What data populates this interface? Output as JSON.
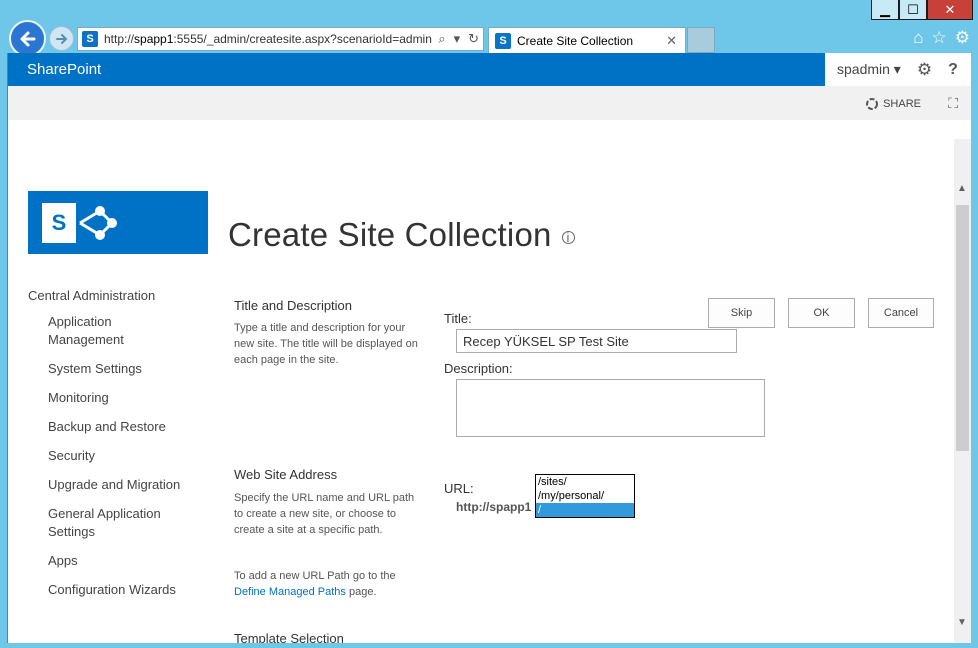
{
  "window": {
    "minimize_glyph": "▁",
    "maximize_glyph": "☐",
    "close_glyph": "✕"
  },
  "browser": {
    "address_prefix": "http://",
    "address_host": "spapp1",
    "address_rest": ":5555/_admin/createsite.aspx?scenarioId=admin",
    "tab_title": "Create Site Collection",
    "tab_close_glyph": "✕"
  },
  "suitebar": {
    "brand": "SharePoint",
    "user": "spadmin ▾",
    "help_glyph": "?"
  },
  "ribbon": {
    "share_label": "SHARE"
  },
  "page": {
    "title": "Create Site Collection",
    "info_glyph": "i",
    "logo_letter": "S"
  },
  "quick_launch": {
    "root": "Central Administration",
    "items": [
      "Application Management",
      "System Settings",
      "Monitoring",
      "Backup and Restore",
      "Security",
      "Upgrade and Migration",
      "General Application Settings",
      "Apps",
      "Configuration Wizards"
    ]
  },
  "actions": {
    "skip": "Skip",
    "ok": "OK",
    "cancel": "Cancel"
  },
  "sections": {
    "title_desc": {
      "heading": "Title and Description",
      "description": "Type a title and description for your new site. The title will be displayed on each page in the site.",
      "title_label": "Title:",
      "title_value": "Recep YÜKSEL SP Test Site",
      "description_label": "Description:",
      "description_value": ""
    },
    "web_address": {
      "heading": "Web Site Address",
      "description": "Specify the URL name and URL path to create a new site, or choose to create a site at a specific path.",
      "managed_paths_prefix": "To add a new URL Path go to the",
      "managed_paths_link": "Define Managed Paths",
      "managed_paths_suffix": " page.",
      "url_label": "URL:",
      "host": "http://spapp1",
      "path_options": [
        "/sites/",
        "/my/personal/",
        "/"
      ],
      "selected_path": "/"
    },
    "template": {
      "heading": "Template Selection"
    }
  },
  "colors": {
    "suitebar": "#0072c6",
    "ribbon": "#f1f1f1",
    "selection": "#3399dd"
  }
}
